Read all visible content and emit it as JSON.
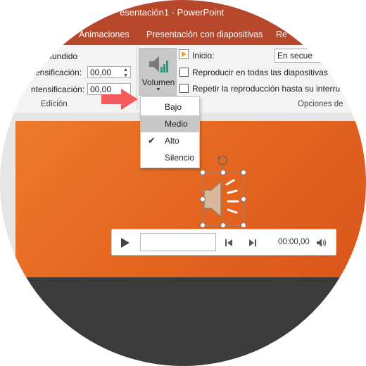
{
  "window": {
    "title": "esentación1 - PowerPoint"
  },
  "tabs": [
    {
      "label": "Animaciones"
    },
    {
      "label": "Presentación con diapositivas"
    },
    {
      "label": "Re"
    }
  ],
  "edit_group": {
    "fade_label": "le fundido",
    "fade_in_label": "ensificación:",
    "fade_in_value": "00,00",
    "fade_out_label": "ntensificación:",
    "fade_out_value": "00,00",
    "group_label": "Edición"
  },
  "volume_button": {
    "label": "Volumen",
    "icon": "speaker-volume-icon"
  },
  "options_group": {
    "start_label": "Inicio:",
    "start_value": "En secue",
    "play_across_label": "Reproducir en todas las diapositivas",
    "loop_label": "Repetir la reproducción hasta su interru",
    "group_label": "Opciones de"
  },
  "volume_menu": {
    "items": [
      {
        "label": "Bajo",
        "checked": false,
        "highlighted": false
      },
      {
        "label": "Medio",
        "checked": false,
        "highlighted": true
      },
      {
        "label": "Alto",
        "checked": true,
        "highlighted": false
      },
      {
        "label": "Silencio",
        "checked": false,
        "highlighted": false
      }
    ]
  },
  "player": {
    "time": "00:00,00"
  },
  "colors": {
    "accent": "#b7472a",
    "slide": "#e4641f",
    "arrow": "#f25c5c"
  }
}
